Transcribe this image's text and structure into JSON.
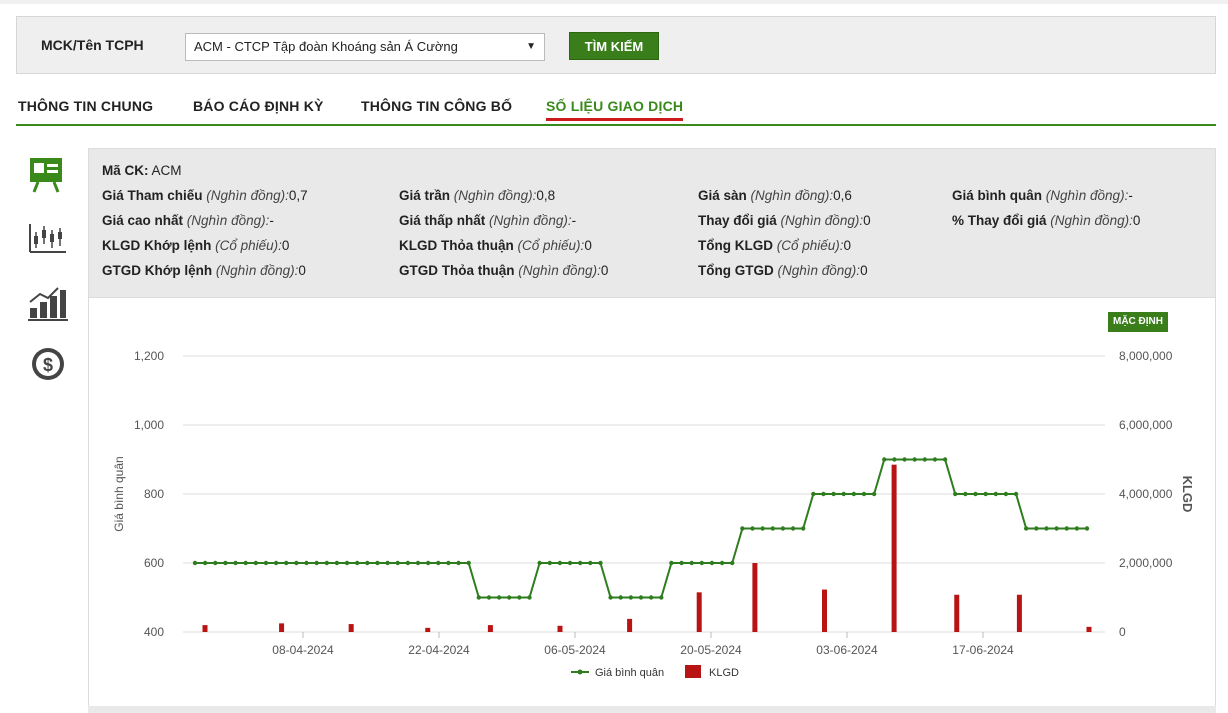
{
  "search": {
    "label": "MCK/Tên TCPH",
    "selected": "ACM - CTCP Tập đoàn Khoáng sản Á Cường",
    "button": "TÌM KIẾM"
  },
  "tabs": [
    {
      "label": "THÔNG TIN CHUNG",
      "active": false
    },
    {
      "label": "BÁO CÁO ĐỊNH KỲ",
      "active": false
    },
    {
      "label": "THÔNG TIN CÔNG BỐ",
      "active": false
    },
    {
      "label": "SỐ LIỆU GIAO DỊCH",
      "active": true
    }
  ],
  "side_icons": [
    "presentation-icon",
    "candlestick-icon",
    "bar-growth-icon",
    "dollar-icon"
  ],
  "info": {
    "ma_ck": {
      "label": "Mã CK:",
      "value": "ACM"
    },
    "items": [
      {
        "label": "Giá Tham chiếu",
        "unit": "(Nghìn đồng):",
        "value": "0,7"
      },
      {
        "label": "Giá trần",
        "unit": "(Nghìn đồng):",
        "value": "0,8"
      },
      {
        "label": "Giá sàn",
        "unit": "(Nghìn đồng):",
        "value": "0,6"
      },
      {
        "label": "Giá bình quân",
        "unit": "(Nghìn đồng):",
        "value": "-"
      },
      {
        "label": "Giá cao nhất",
        "unit": "(Nghìn đồng):",
        "value": "-"
      },
      {
        "label": "Giá thấp nhất",
        "unit": "(Nghìn đồng):",
        "value": "-"
      },
      {
        "label": "Thay đổi giá",
        "unit": "(Nghìn đồng):",
        "value": "0"
      },
      {
        "label": "% Thay đổi giá",
        "unit": "(Nghìn đồng):",
        "value": "0"
      },
      {
        "label": "KLGD Khớp lệnh",
        "unit": "(Cổ phiếu):",
        "value": "0"
      },
      {
        "label": "KLGD Thỏa thuận",
        "unit": "(Cổ phiếu):",
        "value": "0"
      },
      {
        "label": "Tổng KLGD",
        "unit": "(Cổ phiếu):",
        "value": "0"
      },
      {
        "label": "GTGD Khớp lệnh",
        "unit": "(Nghìn đồng):",
        "value": "0"
      },
      {
        "label": "GTGD Thỏa thuận",
        "unit": "(Nghìn đồng):",
        "value": "0"
      },
      {
        "label": "Tổng GTGD",
        "unit": "(Nghìn đồng):",
        "value": "0"
      }
    ]
  },
  "chart_controls": {
    "default_label": "MẶC ĐỊNH"
  },
  "colors": {
    "accent": "#3a7d1b",
    "price_line": "#2e7d1e",
    "volume_bar": "#b81414"
  },
  "chart_data": {
    "type": "line",
    "xlabels": [
      "08-04-2024",
      "22-04-2024",
      "06-05-2024",
      "20-05-2024",
      "03-06-2024",
      "17-06-2024"
    ],
    "ylabel_left": "Giá bình quân",
    "ylabel_right": "KLGD",
    "ylim_left": [
      400,
      1200
    ],
    "yticks_left": [
      "1,200",
      "1,000",
      "800",
      "600",
      "400"
    ],
    "ylim_right": [
      0,
      8000000
    ],
    "yticks_right": [
      "8,000,000",
      "6,000,000",
      "4,000,000",
      "2,000,000",
      "0"
    ],
    "legend": [
      "Giá bình quân",
      "KLGD"
    ],
    "grid": true,
    "price_series": {
      "name": "Giá bình quân",
      "values": [
        600,
        600,
        600,
        600,
        600,
        600,
        600,
        600,
        600,
        600,
        600,
        600,
        600,
        600,
        600,
        600,
        600,
        600,
        600,
        600,
        600,
        600,
        600,
        600,
        600,
        600,
        600,
        600,
        500,
        500,
        500,
        500,
        500,
        500,
        600,
        600,
        600,
        600,
        600,
        600,
        600,
        500,
        500,
        500,
        500,
        500,
        500,
        600,
        600,
        600,
        600,
        600,
        600,
        600,
        700,
        700,
        700,
        700,
        700,
        700,
        700,
        800,
        800,
        800,
        800,
        800,
        800,
        800,
        900,
        900,
        900,
        900,
        900,
        900,
        900,
        800,
        800,
        800,
        800,
        800,
        800,
        800,
        700,
        700,
        700,
        700,
        700,
        700,
        700
      ]
    },
    "volume_series": {
      "name": "KLGD",
      "values": [
        200000,
        0,
        0,
        0,
        0,
        0,
        0,
        0,
        0,
        0,
        0,
        250000,
        0,
        0,
        0,
        0,
        0,
        0,
        0,
        0,
        0,
        230000,
        0,
        0,
        0,
        0,
        0,
        0,
        0,
        0,
        0,
        0,
        120000,
        0,
        0,
        0,
        0,
        0,
        0,
        0,
        0,
        200000,
        0,
        0,
        0,
        0,
        0,
        0,
        0,
        0,
        0,
        180000,
        0,
        0,
        0,
        0,
        0,
        0,
        0,
        0,
        0,
        380000,
        0,
        0,
        0,
        0,
        0,
        0,
        0,
        0,
        0,
        1150000,
        0,
        0,
        0,
        0,
        0,
        0,
        0,
        2000000,
        0,
        0,
        0,
        0,
        0,
        0,
        0,
        0,
        0,
        1230000,
        0,
        0,
        0,
        0,
        0,
        0,
        0,
        0,
        0,
        4850000,
        0,
        0,
        0,
        0,
        0,
        0,
        0,
        0,
        1080000,
        0,
        0,
        0,
        0,
        0,
        0,
        0,
        0,
        1080000,
        0,
        0,
        0,
        0,
        0,
        0,
        0,
        0,
        0,
        150000
      ]
    }
  }
}
